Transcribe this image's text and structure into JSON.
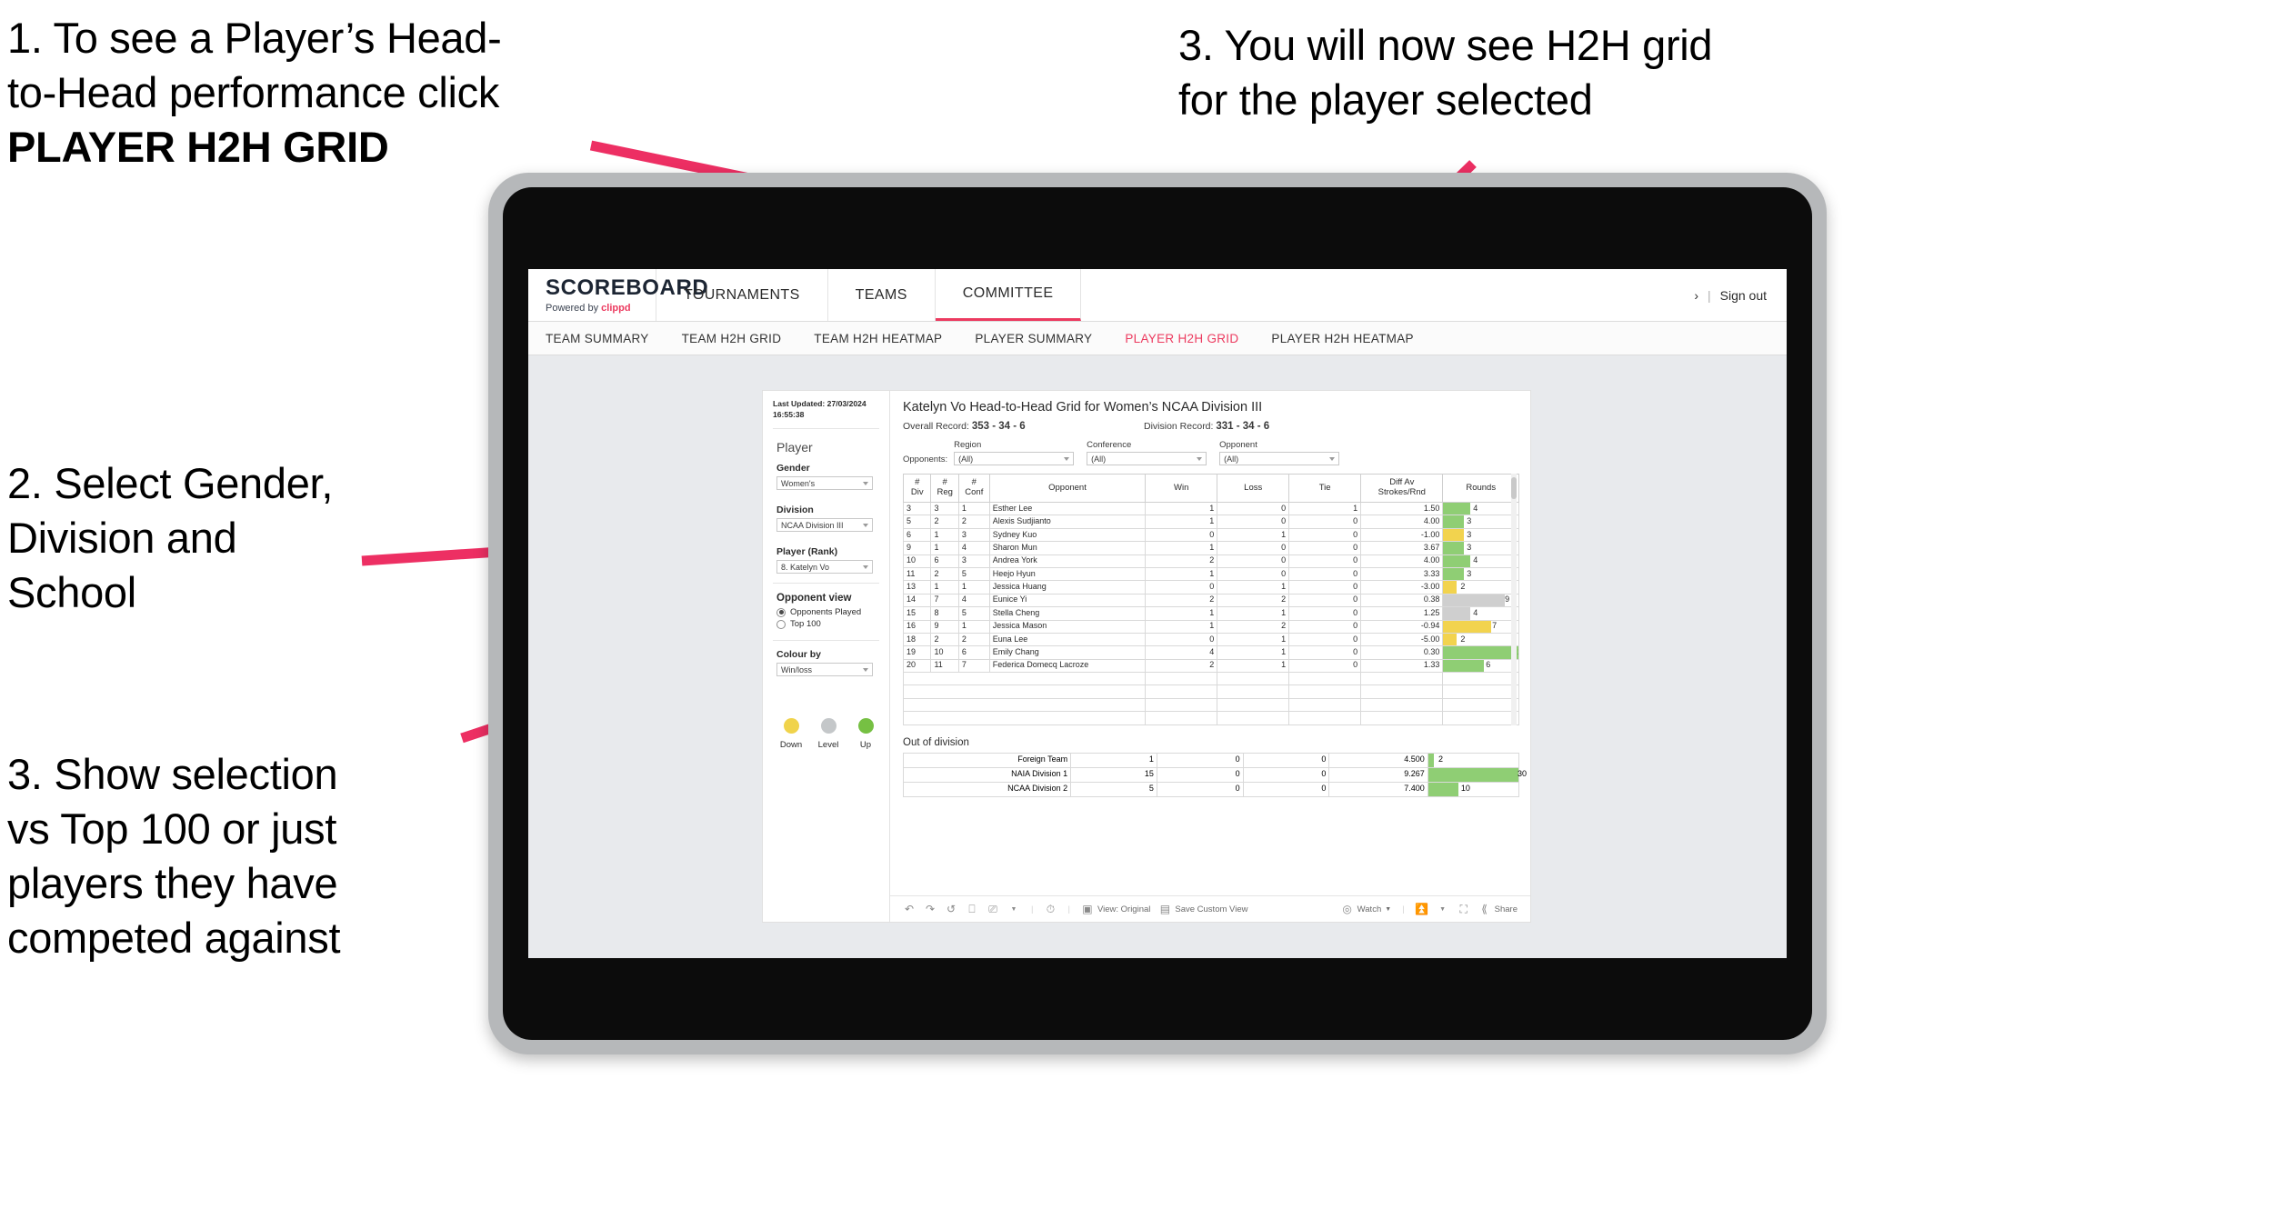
{
  "annotations": [
    {
      "id": "a1",
      "line1": "1. To see a Player’s Head-\nto-Head performance click ",
      "bold": "PLAYER H2H GRID"
    },
    {
      "id": "a2",
      "text": "2. Select Gender,\nDivision and\nSchool"
    },
    {
      "id": "a3",
      "text": "3. Show selection\nvs Top 100 or just\nplayers they have\ncompeted against"
    },
    {
      "id": "a4",
      "text": "3. You will now see H2H grid\nfor the player selected"
    }
  ],
  "colors": {
    "accent": "#ec3a5f",
    "arrow": "#ed2f63",
    "win_green": "#8fce74",
    "loss_yellow": "#f2d34e",
    "level_grey": "#cfcfcf"
  },
  "app": {
    "brand": {
      "name": "SCOREBOARD",
      "powered_prefix": "Powered by ",
      "powered_by": "clippd"
    },
    "top_nav": [
      {
        "label": "TOURNAMENTS",
        "active": false
      },
      {
        "label": "TEAMS",
        "active": false
      },
      {
        "label": "COMMITTEE",
        "active": true
      }
    ],
    "top_right": {
      "user": "›",
      "separator": "|",
      "sign_out": "Sign out"
    },
    "sub_nav": [
      {
        "label": "TEAM SUMMARY",
        "active": false
      },
      {
        "label": "TEAM H2H GRID",
        "active": false
      },
      {
        "label": "TEAM H2H HEATMAP",
        "active": false
      },
      {
        "label": "PLAYER SUMMARY",
        "active": false
      },
      {
        "label": "PLAYER H2H GRID",
        "active": true
      },
      {
        "label": "PLAYER H2H HEATMAP",
        "active": false
      }
    ]
  },
  "sidebar": {
    "last_updated": "Last Updated: 27/03/2024 16:55:38",
    "player_heading": "Player",
    "fields": [
      {
        "label": "Gender",
        "value": "Women's"
      },
      {
        "label": "Division",
        "value": "NCAA Division III"
      },
      {
        "label": "Player (Rank)",
        "value": "8. Katelyn Vo"
      }
    ],
    "opponent_view": {
      "heading": "Opponent view",
      "options": [
        {
          "label": "Opponents Played",
          "selected": true
        },
        {
          "label": "Top 100",
          "selected": false
        }
      ]
    },
    "colour_by": {
      "label": "Colour by",
      "value": "Win/loss"
    },
    "legend": [
      {
        "label": "Down",
        "color": "#f0d34b"
      },
      {
        "label": "Level",
        "color": "#c4c7c9"
      },
      {
        "label": "Up",
        "color": "#76c043"
      }
    ]
  },
  "viz": {
    "title": "Katelyn Vo Head-to-Head Grid for Women’s NCAA Division III",
    "overall_record_label": "Overall Record:",
    "overall_record_value": "353 - 34 - 6",
    "division_record_label": "Division Record:",
    "division_record_value": "331 - 34 - 6",
    "opponents_label": "Opponents:",
    "filters": [
      {
        "name": "Region",
        "value": "(All)"
      },
      {
        "name": "Conference",
        "value": "(All)"
      },
      {
        "name": "Opponent",
        "value": "(All)"
      }
    ],
    "out_of_division_title": "Out of division"
  },
  "chart_data": {
    "type": "table",
    "title": "Katelyn Vo Head-to-Head Grid for Women’s NCAA Division III",
    "columns": [
      "# Div",
      "# Reg",
      "# Conf",
      "Opponent",
      "Win",
      "Loss",
      "Tie",
      "Diff Av Strokes/Rnd",
      "Rounds"
    ],
    "column_headers_multiline": [
      [
        "#",
        "Div"
      ],
      [
        "#",
        "Reg"
      ],
      [
        "#",
        "Conf"
      ],
      [
        "Opponent"
      ],
      [
        "Win"
      ],
      [
        "Loss"
      ],
      [
        "Tie"
      ],
      [
        "Diff Av",
        "Strokes/Rnd"
      ],
      [
        "Rounds"
      ]
    ],
    "rounds_max": 11,
    "rows": [
      {
        "div": "3",
        "reg": "3",
        "conf": "1",
        "opponent": "Esther Lee",
        "win": "1",
        "loss": "0",
        "tie": "1",
        "diff": "1.50",
        "rounds": 4,
        "color": "green"
      },
      {
        "div": "5",
        "reg": "2",
        "conf": "2",
        "opponent": "Alexis Sudjianto",
        "win": "1",
        "loss": "0",
        "tie": "0",
        "diff": "4.00",
        "rounds": 3,
        "color": "green"
      },
      {
        "div": "6",
        "reg": "1",
        "conf": "3",
        "opponent": "Sydney Kuo",
        "win": "0",
        "loss": "1",
        "tie": "0",
        "diff": "-1.00",
        "rounds": 3,
        "color": "yellow"
      },
      {
        "div": "9",
        "reg": "1",
        "conf": "4",
        "opponent": "Sharon Mun",
        "win": "1",
        "loss": "0",
        "tie": "0",
        "diff": "3.67",
        "rounds": 3,
        "color": "green"
      },
      {
        "div": "10",
        "reg": "6",
        "conf": "3",
        "opponent": "Andrea York",
        "win": "2",
        "loss": "0",
        "tie": "0",
        "diff": "4.00",
        "rounds": 4,
        "color": "green"
      },
      {
        "div": "11",
        "reg": "2",
        "conf": "5",
        "opponent": "Heejo Hyun",
        "win": "1",
        "loss": "0",
        "tie": "0",
        "diff": "3.33",
        "rounds": 3,
        "color": "green"
      },
      {
        "div": "13",
        "reg": "1",
        "conf": "1",
        "opponent": "Jessica Huang",
        "win": "0",
        "loss": "1",
        "tie": "0",
        "diff": "-3.00",
        "rounds": 2,
        "color": "yellow"
      },
      {
        "div": "14",
        "reg": "7",
        "conf": "4",
        "opponent": "Eunice Yi",
        "win": "2",
        "loss": "2",
        "tie": "0",
        "diff": "0.38",
        "rounds": 9,
        "color": "grey",
        "diff_color": "green"
      },
      {
        "div": "15",
        "reg": "8",
        "conf": "5",
        "opponent": "Stella Cheng",
        "win": "1",
        "loss": "1",
        "tie": "0",
        "diff": "1.25",
        "rounds": 4,
        "color": "grey",
        "diff_color": "green"
      },
      {
        "div": "16",
        "reg": "9",
        "conf": "1",
        "opponent": "Jessica Mason",
        "win": "1",
        "loss": "2",
        "tie": "0",
        "diff": "-0.94",
        "rounds": 7,
        "color": "yellow"
      },
      {
        "div": "18",
        "reg": "2",
        "conf": "2",
        "opponent": "Euna Lee",
        "win": "0",
        "loss": "1",
        "tie": "0",
        "diff": "-5.00",
        "rounds": 2,
        "color": "yellow"
      },
      {
        "div": "19",
        "reg": "10",
        "conf": "6",
        "opponent": "Emily Chang",
        "win": "4",
        "loss": "1",
        "tie": "0",
        "diff": "0.30",
        "rounds": 11,
        "color": "green"
      },
      {
        "div": "20",
        "reg": "11",
        "conf": "7",
        "opponent": "Federica Domecq Lacroze",
        "win": "2",
        "loss": "1",
        "tie": "0",
        "diff": "1.33",
        "rounds": 6,
        "color": "green"
      }
    ],
    "out_of_division": {
      "rounds_max": 30,
      "rows": [
        {
          "label": "Foreign Team",
          "win": "1",
          "loss": "0",
          "tie": "0",
          "diff": "4.500",
          "rounds": 2,
          "color": "green"
        },
        {
          "label": "NAIA Division 1",
          "win": "15",
          "loss": "0",
          "tie": "0",
          "diff": "9.267",
          "rounds": 30,
          "color": "green"
        },
        {
          "label": "NCAA Division 2",
          "win": "5",
          "loss": "0",
          "tie": "0",
          "diff": "7.400",
          "rounds": 10,
          "color": "green"
        }
      ]
    }
  },
  "toolbar": {
    "undo": "undo-icon",
    "redo": "redo-icon",
    "revert": "revert-icon",
    "refresh": "refresh-icon",
    "pause": "pause-icon",
    "view_label": "View: Original",
    "save_custom_view": "Save Custom View",
    "watch": "Watch",
    "share": "Share"
  }
}
